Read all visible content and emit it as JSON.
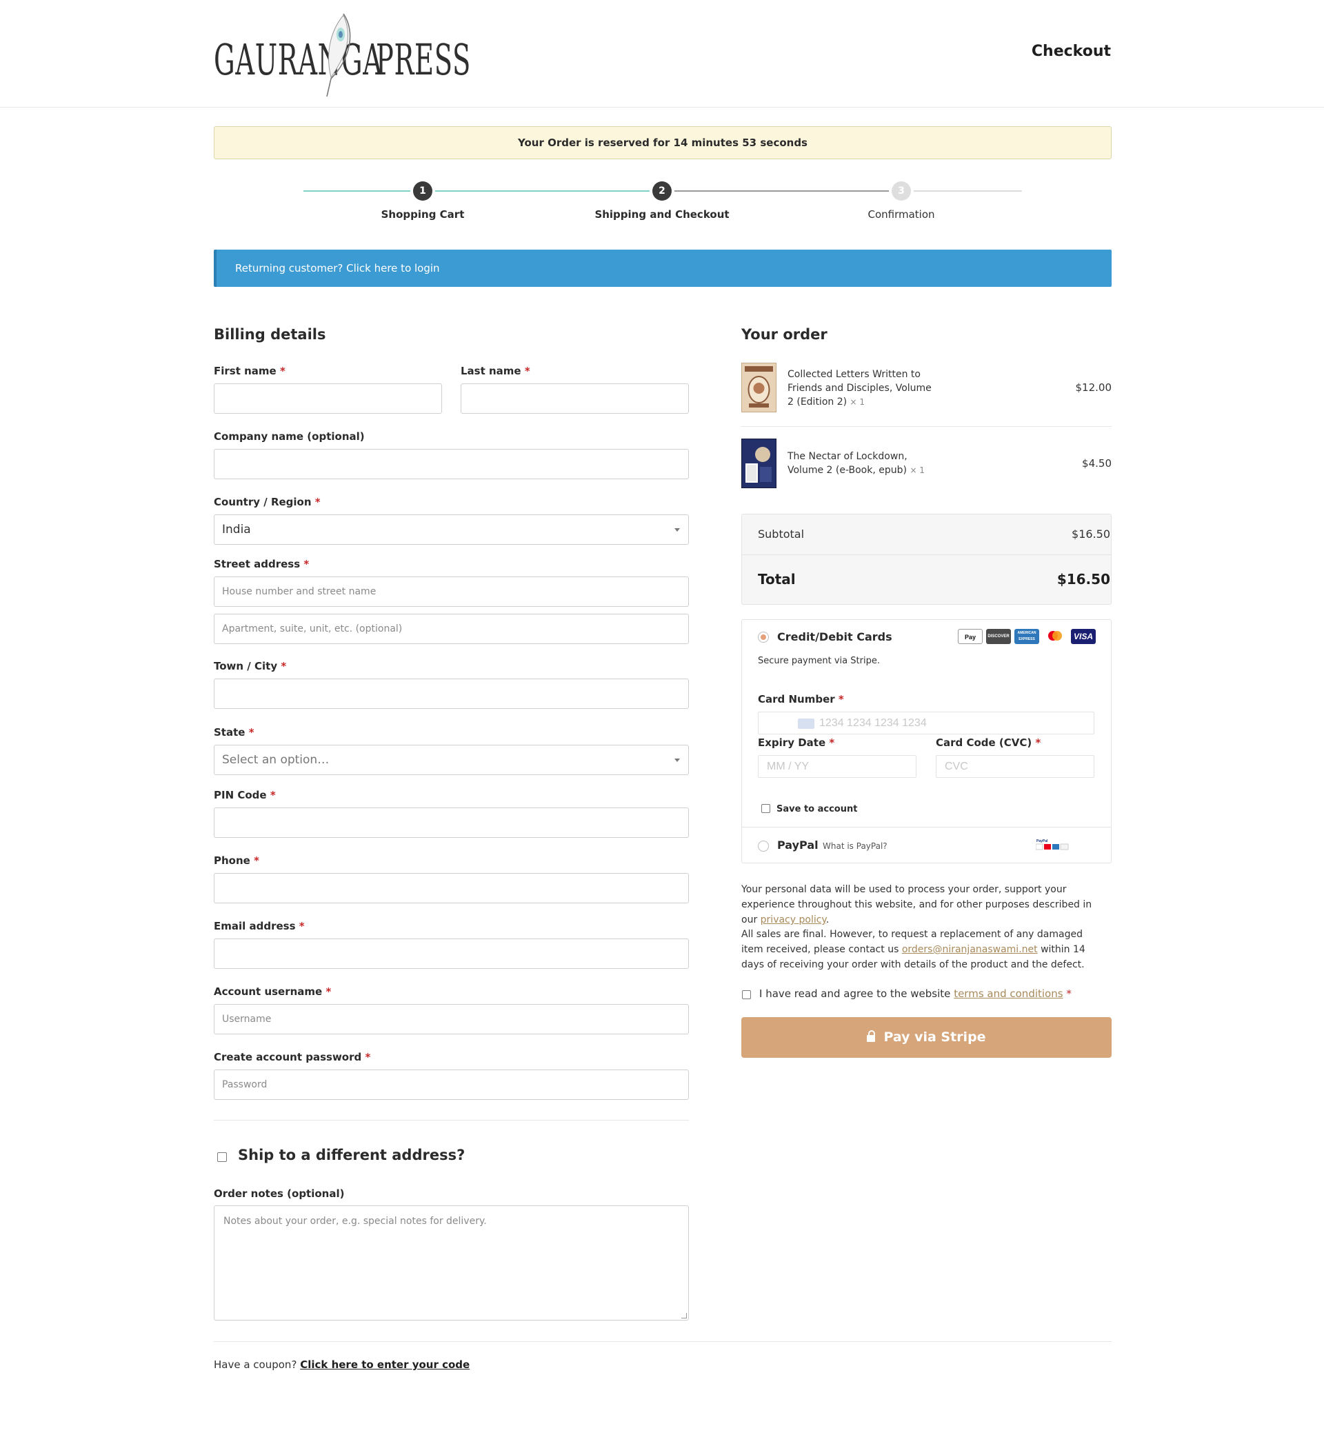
{
  "header": {
    "logo_text_left": "GAURANGA",
    "logo_text_right": "PRESS",
    "title": "Checkout"
  },
  "reserve_banner": {
    "text_prefix": "Your Order is reserved for",
    "minutes": "14 minutes",
    "seconds": "53 seconds"
  },
  "steps": [
    {
      "number": "1",
      "label": "Shopping Cart"
    },
    {
      "number": "2",
      "label": "Shipping and Checkout"
    },
    {
      "number": "3",
      "label": "Confirmation"
    }
  ],
  "login_banner": "Returning customer? Click here to login",
  "billing": {
    "title": "Billing details",
    "first_name_label": "First name",
    "last_name_label": "Last name",
    "company_label": "Company name (optional)",
    "country_label": "Country / Region",
    "country_value": "India",
    "street_label": "Street address",
    "street_placeholder": "House number and street name",
    "street2_placeholder": "Apartment, suite, unit, etc. (optional)",
    "city_label": "Town / City",
    "state_label": "State",
    "state_placeholder": "Select an option…",
    "pin_label": "PIN Code",
    "phone_label": "Phone",
    "email_label": "Email address",
    "username_label": "Account username",
    "username_placeholder": "Username",
    "password_label": "Create account password",
    "password_placeholder": "Password",
    "required_mark": "*"
  },
  "ship_different": "Ship to a different address?",
  "order_notes": {
    "label": "Order notes (optional)",
    "placeholder": "Notes about your order, e.g. special notes for delivery."
  },
  "coupon": {
    "text": "Have a coupon?",
    "link": "Click here to enter your code"
  },
  "order": {
    "title": "Your order",
    "items": [
      {
        "name": "Collected Letters Written to Friends and Disciples, Volume 2 (Edition 2)",
        "qty": "× 1",
        "price": "$12.00"
      },
      {
        "name": "The Nectar of Lockdown, Volume 2 (e-Book, epub)",
        "qty": "× 1",
        "price": "$4.50"
      }
    ],
    "subtotal_label": "Subtotal",
    "subtotal_value": "$16.50",
    "total_label": "Total",
    "total_value": "$16.50"
  },
  "payment": {
    "card_title": "Credit/Debit Cards",
    "card_desc": "Secure payment via Stripe.",
    "brands": [
      "Pay",
      "DISCOVER",
      "AMERICAN EXPRESS",
      "",
      "VISA"
    ],
    "card_number_label": "Card Number",
    "card_number_placeholder": "1234 1234 1234 1234",
    "expiry_label": "Expiry Date",
    "expiry_placeholder": "MM / YY",
    "cvc_label": "Card Code (CVC)",
    "cvc_placeholder": "CVC",
    "save_label": "Save to account",
    "paypal_title": "PayPal",
    "paypal_link": "What is PayPal?"
  },
  "privacy": {
    "text": "Your personal data will be used to process your order, support your experience throughout this website, and for other purposes described in our",
    "link": "privacy policy",
    "end": "."
  },
  "sales": {
    "text1": "All sales are final. However, to request a replacement of any damaged item received, please contact us",
    "email": "orders@niranjanaswami.net",
    "text2": "within 14 days of receiving your order with details of the product and the defect."
  },
  "terms": {
    "text": "I have read and agree to the website",
    "link": "terms and conditions"
  },
  "pay_button": "Pay via Stripe",
  "colors": {
    "accent_blue": "#3d9bd3",
    "pay_button": "#d6a57a",
    "required": "#c62828",
    "step_done_line": "#7fd3c4",
    "banner_bg": "#fbf6dc"
  }
}
